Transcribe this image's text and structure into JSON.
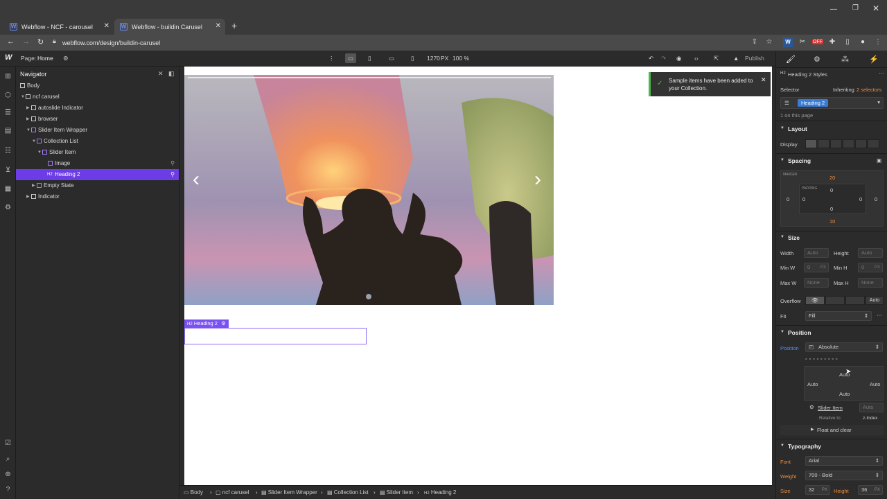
{
  "browser": {
    "tabs": [
      {
        "title": "Webflow - NCF - carousel",
        "icon": "webflow-icon"
      },
      {
        "title": "Webflow - buildin Carusel",
        "icon": "webflow-icon"
      }
    ],
    "new_tab": "+",
    "url": "webflow.com/design/buildin-carusel",
    "ext_badge": "OFF"
  },
  "topbar": {
    "logo": "W",
    "page_label": "Page:",
    "page_name": "Home",
    "width_readout": "1270",
    "width_unit": "PX",
    "zoom": "100 %",
    "publish": "Publish"
  },
  "navigator": {
    "title": "Navigator",
    "items": [
      {
        "label": "Body",
        "depth": 0
      },
      {
        "label": "ncf carusel",
        "depth": 1
      },
      {
        "label": "autoslide Indicator",
        "depth": 2
      },
      {
        "label": "browser",
        "depth": 2
      },
      {
        "label": "Slider Item Wrapper",
        "depth": 2
      },
      {
        "label": "Collection List",
        "depth": 3
      },
      {
        "label": "Slider Item",
        "depth": 4
      },
      {
        "label": "Image",
        "depth": 5
      },
      {
        "label": "Heading 2",
        "depth": 5,
        "selected": true
      },
      {
        "label": "Empty State",
        "depth": 3
      },
      {
        "label": "Indicator",
        "depth": 2
      }
    ]
  },
  "canvas": {
    "prev_arrow": "‹",
    "next_arrow": "›",
    "heading_tag": "Heading 2",
    "heading_tag_prefix": "H2"
  },
  "toast": {
    "message": "Sample items have been added to your Collection.",
    "accent": "#4db84d"
  },
  "breadcrumbs": [
    "Body",
    "ncf carusel",
    "Slider Item Wrapper",
    "Collection List",
    "Slider Item",
    "Heading 2"
  ],
  "panel": {
    "styles_title": "Heading 2 Styles",
    "selector_label": "Selector",
    "inheriting": "Inheriting",
    "inheriting_count": "2 selectors",
    "selector_value": "Heading 2",
    "on_page": "1 on this page",
    "layout": {
      "title": "Layout",
      "display_label": "Display"
    },
    "spacing": {
      "title": "Spacing",
      "margin_label": "MARGIN",
      "padding_label": "PADDING",
      "margin_top": "20",
      "margin_right": "0",
      "margin_bottom": "10",
      "margin_left": "0",
      "padding_top": "0",
      "padding_right": "0",
      "padding_bottom": "0",
      "padding_left": "0"
    },
    "size": {
      "title": "Size",
      "width_label": "Width",
      "width_value": "Auto",
      "height_label": "Height",
      "height_value": "Auto",
      "minw_label": "Min W",
      "minw_value": "0",
      "minw_unit": "PX",
      "minh_label": "Min H",
      "minh_value": "0",
      "minh_unit": "PX",
      "maxw_label": "Max W",
      "maxw_value": "None",
      "maxh_label": "Max H",
      "maxh_value": "None",
      "overflow_label": "Overflow",
      "overflow_auto": "Auto",
      "fit_label": "Fit",
      "fit_value": "Fill"
    },
    "position": {
      "title": "Position",
      "position_label": "Position",
      "position_value": "Absolute",
      "top": "Auto",
      "left": "Auto",
      "right": "Auto",
      "bottom": "Auto",
      "relative_item": "Slider Item",
      "relative_to": "Relative to",
      "zindex_value": "Auto",
      "zindex_label": "z-Index",
      "float_clear": "Float and clear"
    },
    "typography": {
      "title": "Typography",
      "font_label": "Font",
      "font_value": "Arial",
      "weight_label": "Weight",
      "weight_value": "700 - Bold",
      "size_label": "Size",
      "size_value": "32",
      "size_unit": "PX",
      "height_label": "Height",
      "height_value": "36",
      "height_unit": "PX"
    }
  }
}
